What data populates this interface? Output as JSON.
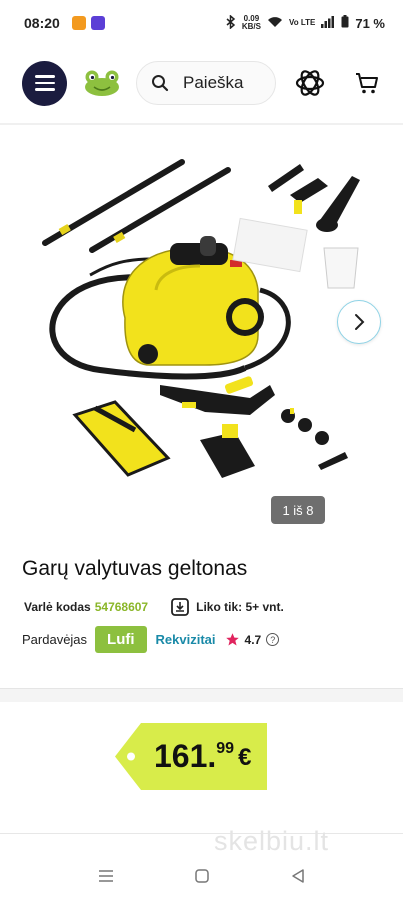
{
  "status_bar": {
    "time": "08:20",
    "speed": "0.09",
    "speed_unit": "KB/S",
    "network": "Vo LTE",
    "battery": "71 %"
  },
  "header": {
    "search_placeholder": "Paieška",
    "menu_icon": "hamburger-icon",
    "logo_icon": "frog-logo-icon",
    "ai_icon": "openai-icon",
    "cart_icon": "cart-icon"
  },
  "gallery": {
    "counter": "1 iš 8"
  },
  "product": {
    "title": "Garų valytuvas geltonas",
    "code_label": "Varlė kodas",
    "code_value": "54768607",
    "stock_text": "Liko tik: 5+ vnt.",
    "seller_label": "Pardavėjas",
    "seller_name": "Lufi",
    "rekvizitai": "Rekvizitai",
    "rating": "4.7"
  },
  "price": {
    "integer": "161.",
    "decimals": "99",
    "currency": "€"
  },
  "watermark": "skelbiu.lt",
  "colors": {
    "accent_green": "#8dc03f",
    "price_tag": "#d8ec4a",
    "link_blue": "#1a8aa8",
    "menu_dark": "#1b1c3f"
  }
}
